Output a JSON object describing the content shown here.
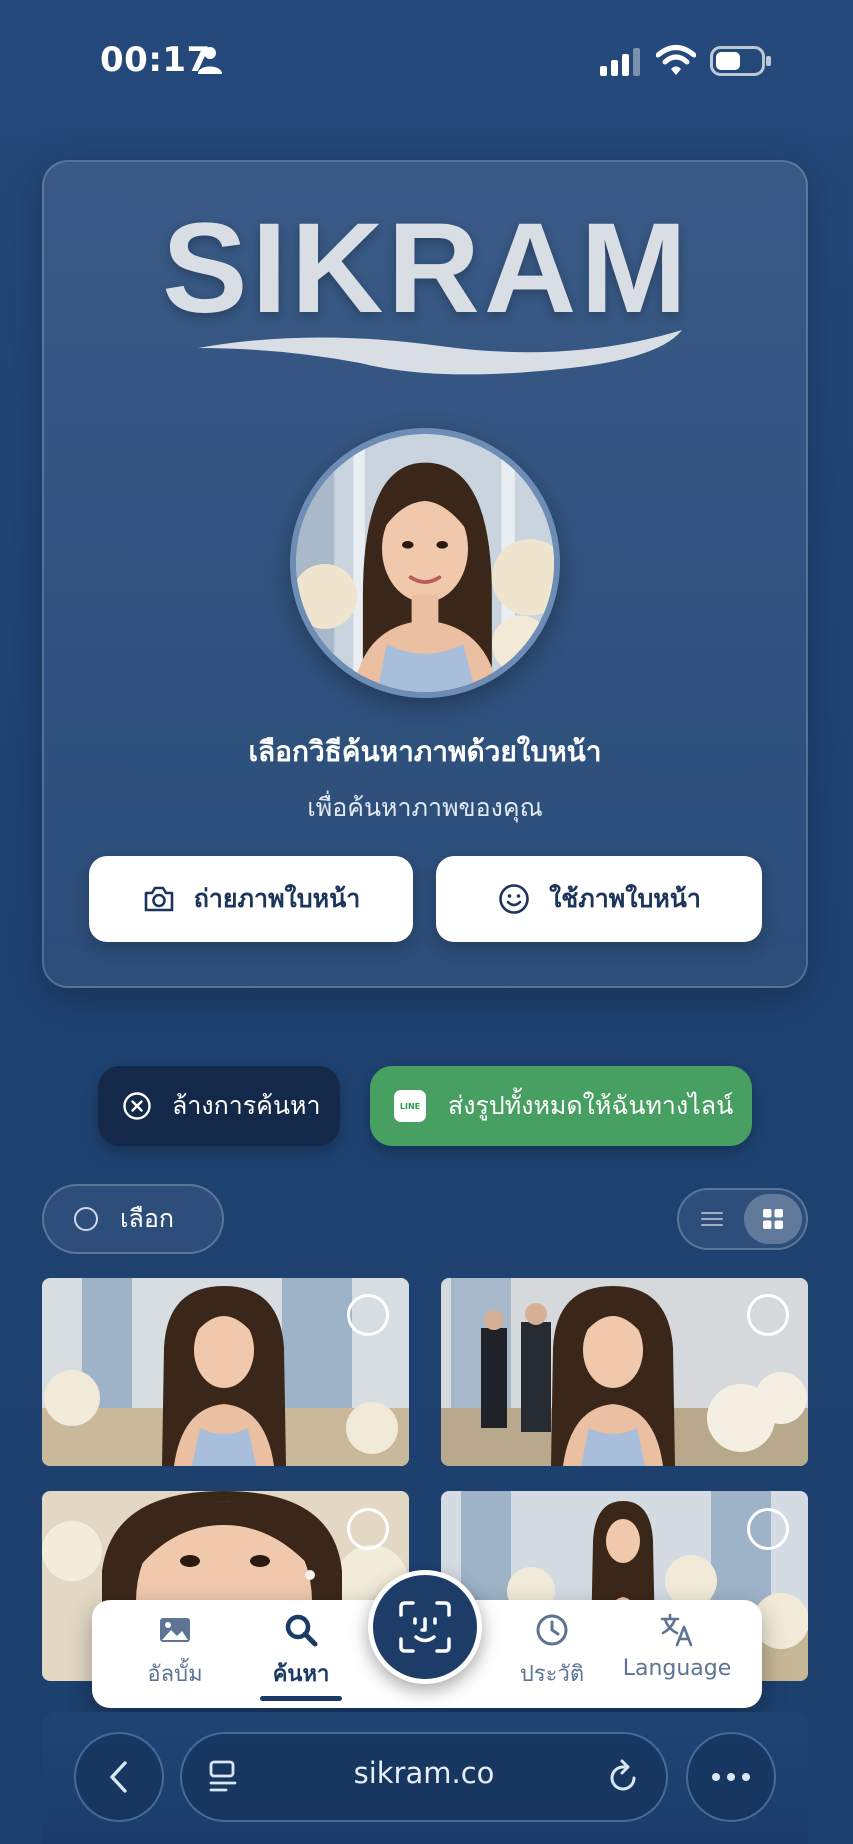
{
  "status_bar": {
    "time": "00:17"
  },
  "card": {
    "logo_text": "SIKRAM",
    "title": "เลือกวิธีค้นหาภาพด้วยใบหน้า",
    "subtitle": "เพื่อค้นหาภาพของคุณ",
    "take_photo_label": "ถ่ายภาพใบหน้า",
    "use_photo_label": "ใช้ภาพใบหน้า"
  },
  "actions": {
    "clear_label": "ล้างการค้นหา",
    "line_label": "ส่งรูปทั้งหมดให้ฉันทางไลน์",
    "line_icon_text": "LINE"
  },
  "toolbar": {
    "select_label": "เลือก"
  },
  "tabbar": {
    "items": [
      {
        "label": "อัลบั้ม",
        "icon": "image-icon"
      },
      {
        "label": "ค้นหา",
        "icon": "search-icon",
        "active": true
      },
      {
        "label": "ประวัติ",
        "icon": "clock-icon"
      },
      {
        "label": "Language",
        "icon": "translate-icon"
      }
    ]
  },
  "browser": {
    "url": "sikram.co"
  },
  "colors": {
    "background": "#1f4372",
    "accent_dark": "#1b3a66",
    "line_green": "#47a062",
    "clear_pill": "#14284a"
  }
}
